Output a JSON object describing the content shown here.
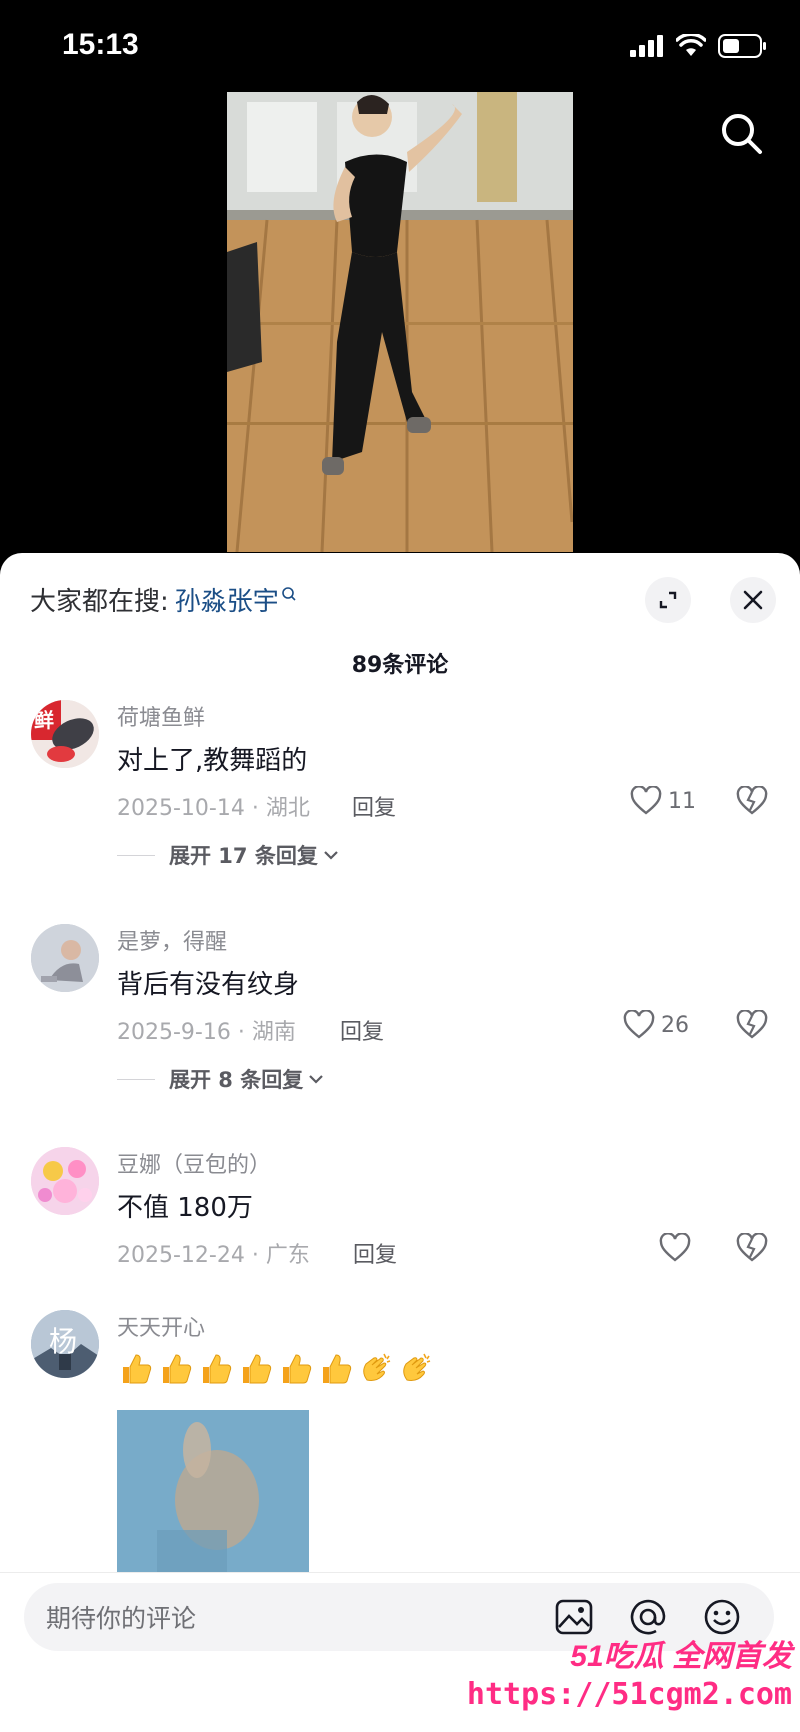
{
  "status_bar": {
    "time": "15:13"
  },
  "hot_search": {
    "prefix": "大家都在搜:",
    "term": "孙淼张宇"
  },
  "comment_count": "89条评论",
  "comments": [
    {
      "username": "荷塘鱼鲜",
      "text": "对上了,教舞蹈的",
      "date_location": "2025-10-14 · 湖北",
      "reply_label": "回复",
      "likes": "11",
      "expand_label": "展开 17 条回复"
    },
    {
      "username": "是萝，得醒",
      "text": "背后有没有纹身",
      "date_location": "2025-9-16 · 湖南",
      "reply_label": "回复",
      "likes": "26",
      "expand_label": "展开 8 条回复"
    },
    {
      "username": "豆娜（豆包的）",
      "text": "不值 180万",
      "date_location": "2025-12-24 · 广东",
      "reply_label": "回复",
      "likes": ""
    },
    {
      "username": "天天开心",
      "avatar_char": "杨",
      "emojis": [
        "thumbs-up",
        "thumbs-up",
        "thumbs-up",
        "thumbs-up",
        "thumbs-up",
        "thumbs-up",
        "clap",
        "clap"
      ]
    }
  ],
  "avatar_text_1": "鲜",
  "input": {
    "placeholder": "期待你的评论"
  },
  "watermark": {
    "line1": "51吃瓜 全网首发",
    "line2": "https://51cgm2.com"
  }
}
